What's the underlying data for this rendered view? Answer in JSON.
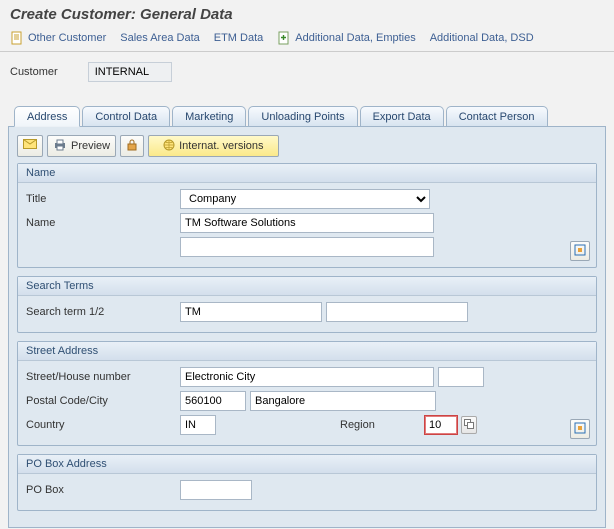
{
  "title": "Create Customer: General Data",
  "toolbar": {
    "other_customer": "Other Customer",
    "sales_area_data": "Sales Area Data",
    "etm_data": "ETM Data",
    "additional_data_empties": "Additional Data, Empties",
    "additional_data_dsd": "Additional Data, DSD"
  },
  "customer": {
    "label": "Customer",
    "value": "INTERNAL"
  },
  "tabs": {
    "address": "Address",
    "control_data": "Control Data",
    "marketing": "Marketing",
    "unloading_points": "Unloading Points",
    "export_data": "Export Data",
    "contact_person": "Contact Person"
  },
  "panel_buttons": {
    "preview": "Preview",
    "internat_versions": "Internat. versions"
  },
  "groups": {
    "name": {
      "header": "Name",
      "title_label": "Title",
      "title_value": "Company",
      "name_label": "Name",
      "name_value": "TM Software Solutions",
      "name2_value": ""
    },
    "search": {
      "header": "Search Terms",
      "term_label": "Search term 1/2",
      "term1": "TM",
      "term2": ""
    },
    "street": {
      "header": "Street Address",
      "street_label": "Street/House number",
      "street_value": "Electronic City",
      "house_no": "",
      "postal_label": "Postal Code/City",
      "postal_value": "560100",
      "city_value": "Bangalore",
      "country_label": "Country",
      "country_value": "IN",
      "region_label": "Region",
      "region_value": "10"
    },
    "pobox": {
      "header": "PO Box Address",
      "pobox_label": "PO Box",
      "pobox_value": ""
    }
  }
}
